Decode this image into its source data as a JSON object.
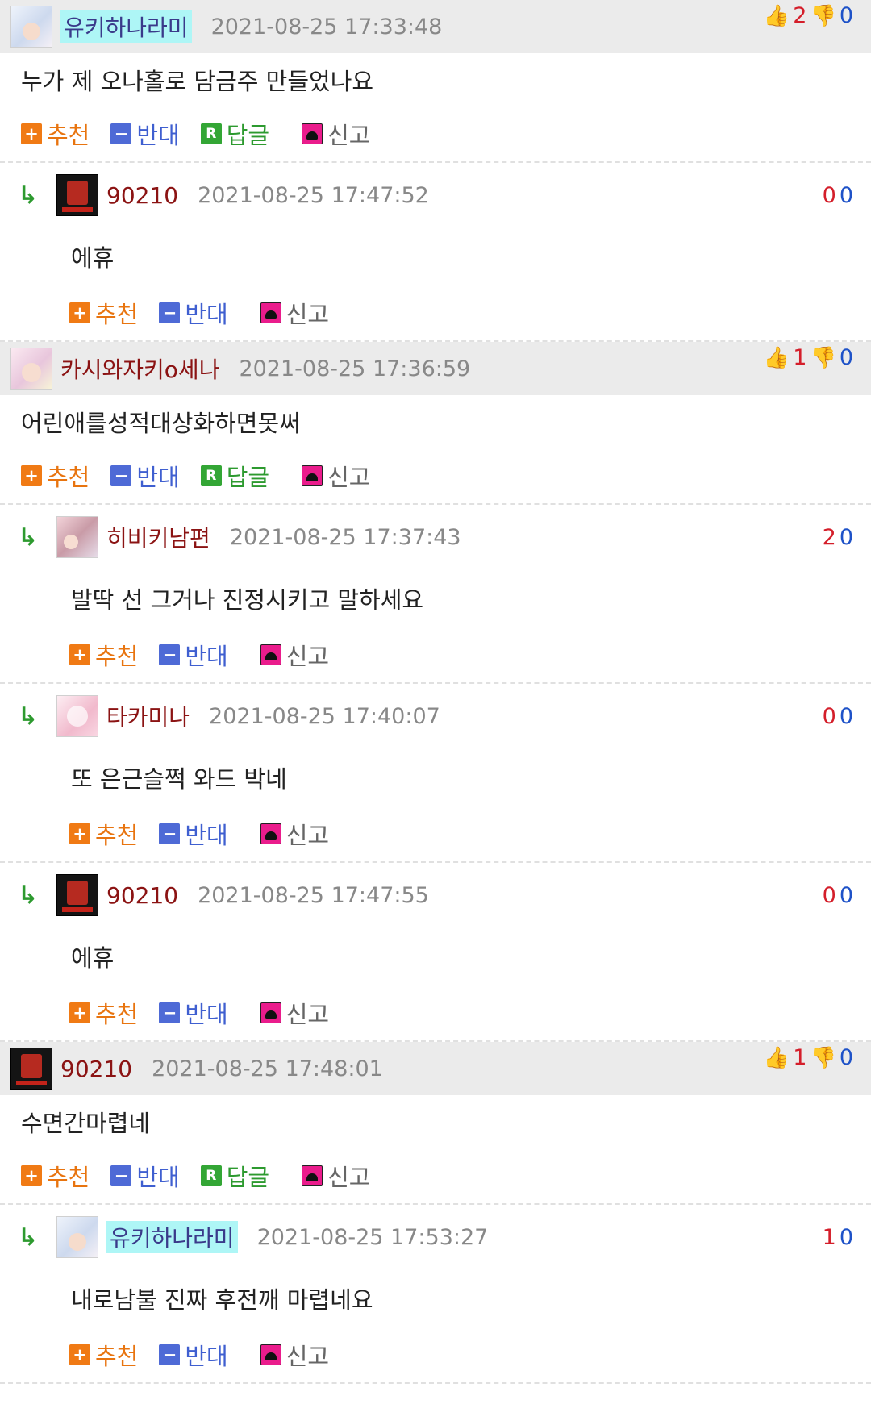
{
  "comments": [
    {
      "nick": "유키하나라미",
      "time": "2021-08-25 17:33:48",
      "up": "2",
      "down": "0",
      "text": "누가 제 오나홀로 담금주 만들었나요",
      "replies": [
        {
          "nick": "90210",
          "time": "2021-08-25 17:47:52",
          "up": "0",
          "down": "0",
          "text": "에휴"
        }
      ]
    },
    {
      "nick": "카시와자키o세나",
      "time": "2021-08-25 17:36:59",
      "up": "1",
      "down": "0",
      "text": "어린애를성적대상화하면못써",
      "replies": [
        {
          "nick": "히비키남편",
          "time": "2021-08-25 17:37:43",
          "up": "2",
          "down": "0",
          "text": "발딱 선 그거나 진정시키고 말하세요"
        },
        {
          "nick": "타카미나",
          "time": "2021-08-25 17:40:07",
          "up": "0",
          "down": "0",
          "text": "또 은근슬쩍 와드 박네"
        },
        {
          "nick": "90210",
          "time": "2021-08-25 17:47:55",
          "up": "0",
          "down": "0",
          "text": "에휴"
        }
      ]
    },
    {
      "nick": "90210",
      "time": "2021-08-25 17:48:01",
      "up": "1",
      "down": "0",
      "text": "수면간마렵네",
      "replies": [
        {
          "nick": "유키하나라미",
          "time": "2021-08-25 17:53:27",
          "up": "1",
          "down": "0",
          "text": "내로남불 진짜 후전깨 마렵네요"
        }
      ]
    }
  ],
  "labels": {
    "recommend": "추천",
    "oppose": "반대",
    "reply": "답글",
    "report": "신고",
    "recommend_icon": "+",
    "oppose_icon": "−",
    "reply_icon": "R",
    "reply_arrow": "↳",
    "thumb_up": "👍",
    "thumb_down": "👎"
  },
  "colors": {
    "header_bg": "#ebebeb",
    "recommend": "#e8740f",
    "oppose": "#3f5fd0",
    "reply": "#2d9a2f",
    "up_count": "#d41e2a",
    "down_count": "#1e52c8",
    "nick_highlight": "#aef6f6",
    "nick_red": "#8b1313"
  },
  "icons": {
    "recommend": "plus-icon",
    "oppose": "minus-icon",
    "reply": "reply-r-icon",
    "report": "siren-icon",
    "vote_up": "thumbs-up-icon",
    "vote_down": "thumbs-down-icon"
  }
}
